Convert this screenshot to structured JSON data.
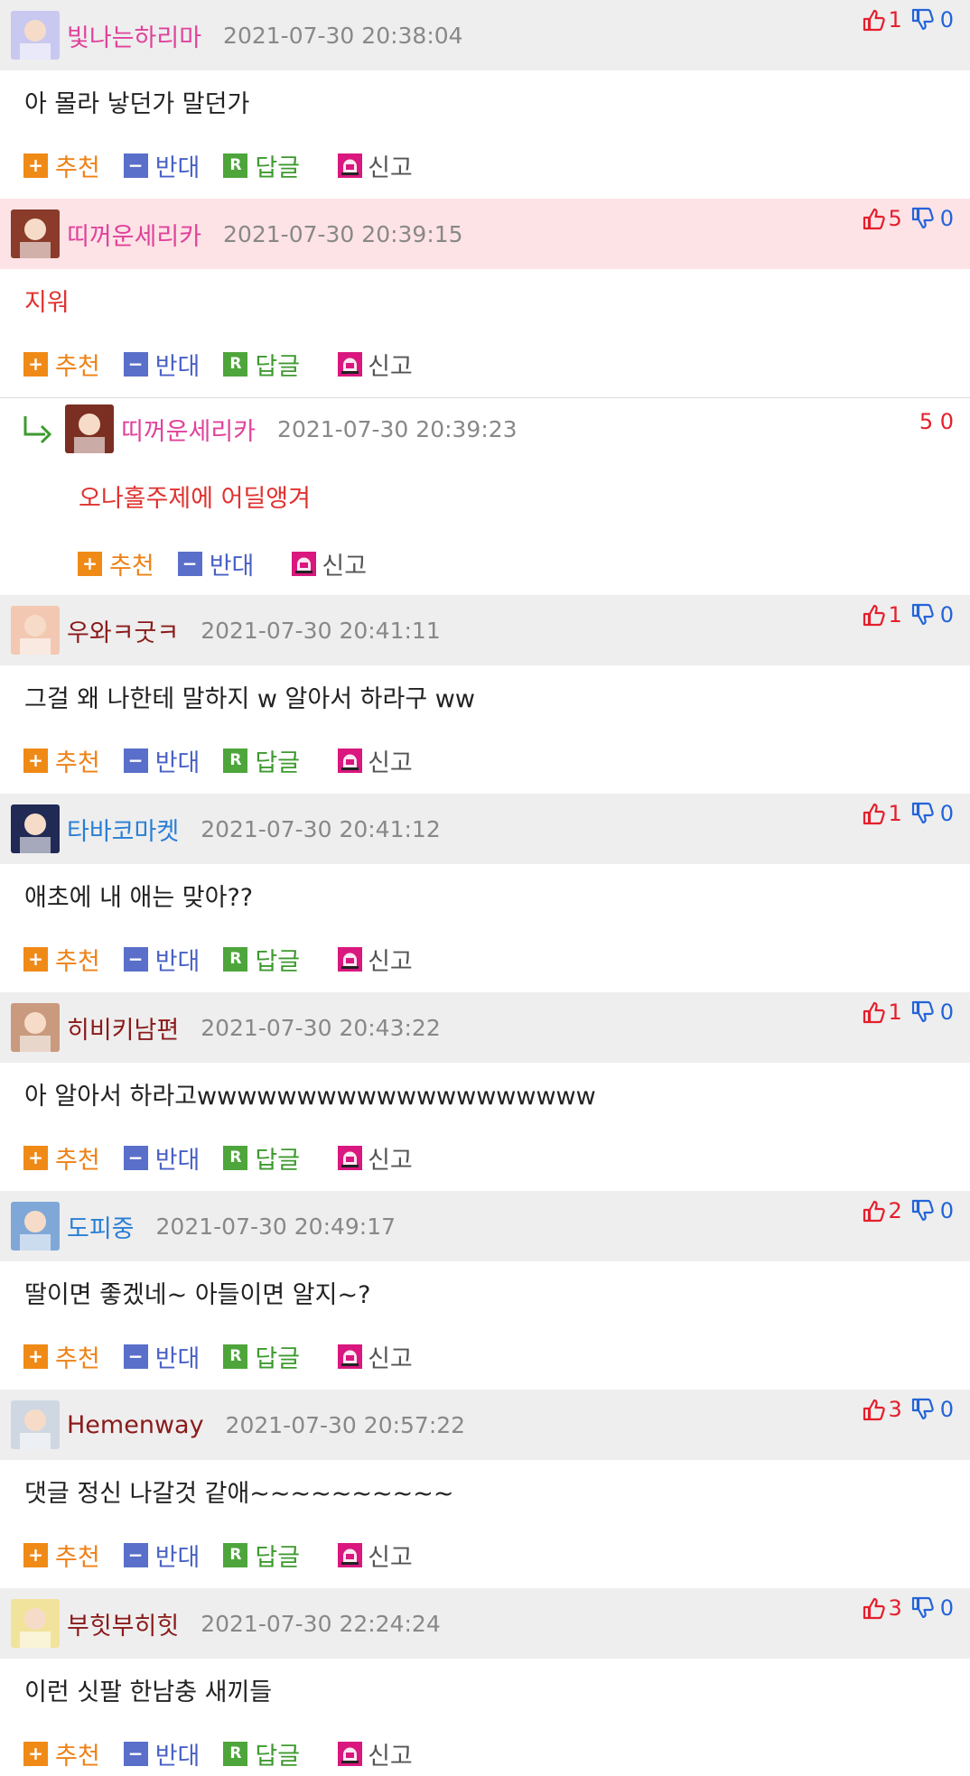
{
  "colors": {
    "up": "#e41f2c",
    "down": "#2364d8",
    "recommend": "#ef8116",
    "oppose": "#4961c4",
    "reply": "#3e9a2f"
  },
  "actions": {
    "recommend": "추천",
    "oppose": "반대",
    "reply": "답글",
    "report": "신고",
    "reply_box": "R"
  },
  "comments": [
    {
      "nick": "빛나는하리마",
      "nick_color": "#e0439b",
      "date": "2021-07-30 20:38:04",
      "up": "1",
      "down": "0",
      "text": "아 몰라 낳던가 말던가",
      "avatar": "avatar-1"
    },
    {
      "nick": "띠꺼운세리카",
      "nick_color": "#e0439b",
      "date": "2021-07-30 20:39:15",
      "up": "5",
      "down": "0",
      "text": "지워",
      "text_red": true,
      "highlight": true,
      "avatar": "avatar-2"
    },
    {
      "nick": "우와ㅋ굿ㅋ",
      "nick_color": "#8b1a1a",
      "date": "2021-07-30 20:41:11",
      "up": "1",
      "down": "0",
      "text": "그걸 왜 나한테 말하지 w 알아서 하라구 ww",
      "avatar": "avatar-4"
    },
    {
      "nick": "타바코마켓",
      "nick_color": "#2a7fd6",
      "date": "2021-07-30 20:41:12",
      "up": "1",
      "down": "0",
      "text": "애초에 내 애는 맞아??",
      "avatar": "avatar-5"
    },
    {
      "nick": "히비키남편",
      "nick_color": "#8b1a1a",
      "date": "2021-07-30 20:43:22",
      "up": "1",
      "down": "0",
      "text": "아 알아서 하라고wwwwwwwwwwwwwwwwwwww",
      "avatar": "avatar-6"
    },
    {
      "nick": "도피중",
      "nick_color": "#2a7fd6",
      "date": "2021-07-30 20:49:17",
      "up": "2",
      "down": "0",
      "text": "딸이면 좋겠네~ 아들이면 알지~?",
      "avatar": "avatar-7"
    },
    {
      "nick": "Hemenway",
      "nick_color": "#8b1a1a",
      "date": "2021-07-30 20:57:22",
      "up": "3",
      "down": "0",
      "text": "댓글 정신 나갈것 같애~~~~~~~~~~",
      "avatar": "avatar-8"
    },
    {
      "nick": "부힛부히힛",
      "nick_color": "#8b1a1a",
      "date": "2021-07-30 22:24:24",
      "up": "3",
      "down": "0",
      "text": "이런 싯팔 한남충 새끼들",
      "avatar": "avatar-9"
    }
  ],
  "reply": {
    "nick": "띠꺼운세리카",
    "nick_color": "#e0439b",
    "date": "2021-07-30 20:39:23",
    "votes": "5 0",
    "text": "오나홀주제에 어딜앵겨",
    "avatar": "avatar-3"
  }
}
